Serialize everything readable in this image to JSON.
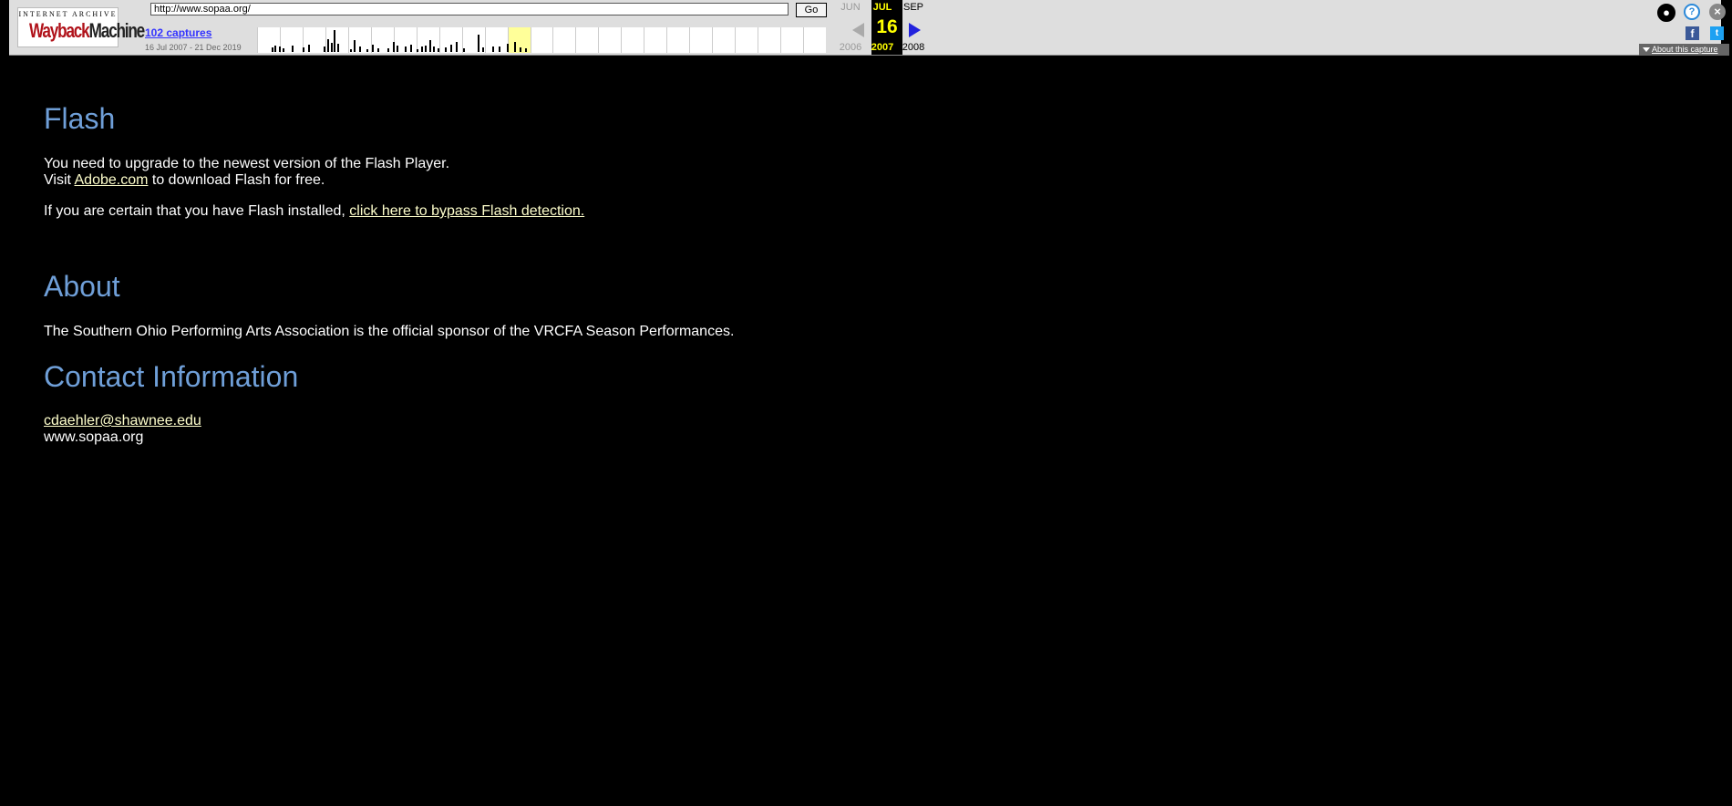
{
  "wayback": {
    "logo_top": "INTERNET ARCHIVE",
    "logo_word1": "Wayback",
    "logo_word2": "Machine",
    "url_value": "http://www.sopaa.org/",
    "go_label": "Go",
    "captures_label": "102 captures",
    "date_range": "16 Jul 2007 - 21 Dec 2019",
    "prev_month": "JUN",
    "cur_month": "JUL",
    "next_month": "SEP",
    "cur_day": "16",
    "prev_year": "2006",
    "cur_year": "2007",
    "next_year": "2008",
    "about_label": "About this capture",
    "facebook_glyph": "f",
    "twitter_glyph": "t",
    "help_glyph": "?",
    "close_glyph": "×",
    "user_glyph": "●",
    "highlight_color": "#ffff99",
    "accent_blue": "#2b89d9"
  },
  "page": {
    "flash_heading": "Flash",
    "flash_line1": "You need to upgrade to the newest version of the Flash Player.",
    "flash_visit": "Visit ",
    "flash_adobe_link": "Adobe.com",
    "flash_visit_rest": " to download Flash for free.",
    "flash_certain": "If you are certain that you have Flash installed, ",
    "flash_bypass_link": "click here to bypass Flash detection.",
    "about_heading": "About",
    "about_text": "The Southern Ohio Performing Arts Association is the official sponsor of the VRCFA Season Performances.",
    "contact_heading": "Contact Information",
    "contact_email": "cdaehler@shawnee.edu",
    "contact_site": "www.sopaa.org",
    "heading_color": "#6f9fd8",
    "link_color": "#ffffcc"
  }
}
